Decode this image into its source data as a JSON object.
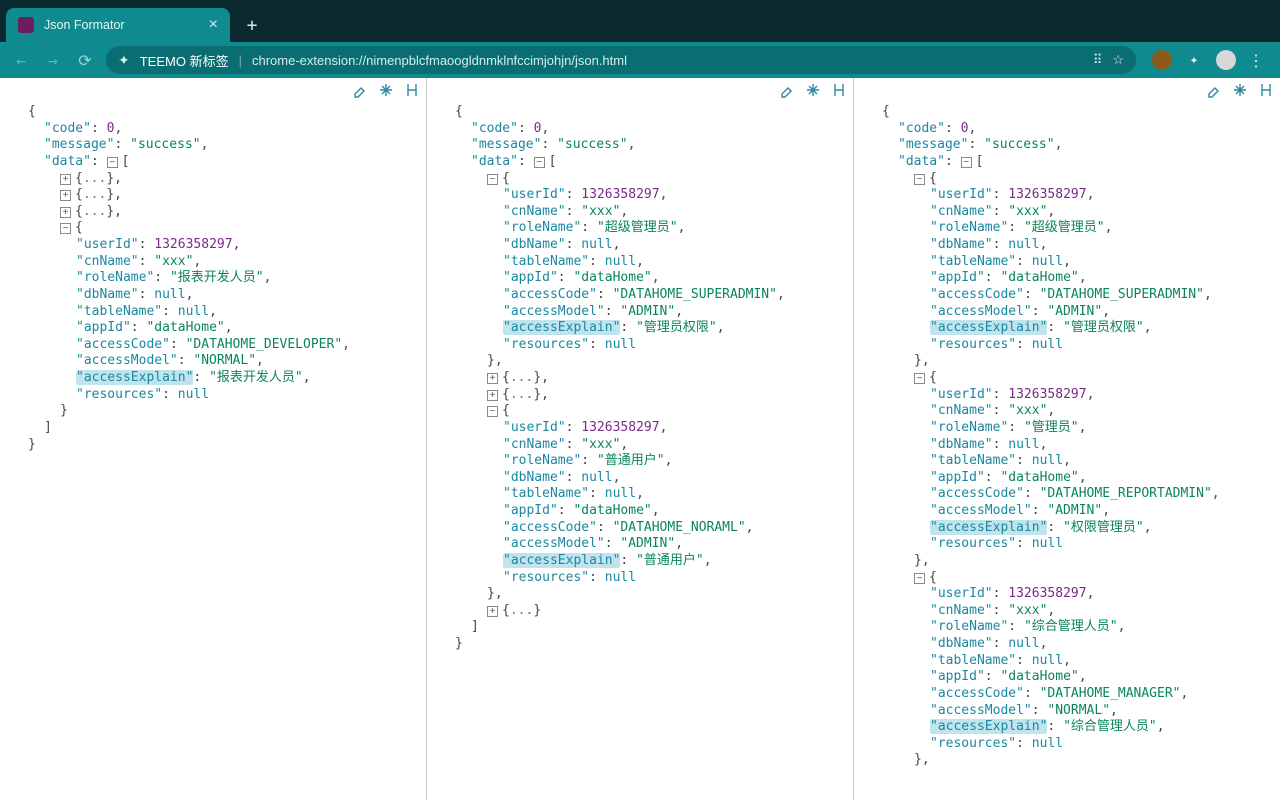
{
  "browser": {
    "tab_title": "Json Formator",
    "url_label": "TEEMO 新标签",
    "url_path": "chrome-extension://nimenpblcfmaoogldnmklnfccimjohjn/json.html"
  },
  "toolbar_icons": {
    "eraser": "eraser-icon",
    "collapse_all": "collapse-all-icon",
    "align": "align-icon"
  },
  "panel1": {
    "root": {
      "code_key": "code",
      "code_val": 0,
      "message_key": "message",
      "message_val": "success",
      "data_key": "data",
      "collapsed_rows": 3,
      "item": {
        "userId_key": "userId",
        "userId_val": 1326358297,
        "cnName_key": "cnName",
        "cnName_val": "xxx",
        "roleName_key": "roleName",
        "roleName_val": "报表开发人员",
        "dbName_key": "dbName",
        "tableName_key": "tableName",
        "appId_key": "appId",
        "appId_val": "dataHome",
        "accessCode_key": "accessCode",
        "accessCode_val": "DATAHOME_DEVELOPER",
        "accessModel_key": "accessModel",
        "accessModel_val": "NORMAL",
        "accessExplain_key": "accessExplain",
        "accessExplain_val": "报表开发人员",
        "resources_key": "resources"
      }
    }
  },
  "panel2": {
    "root": {
      "code_key": "code",
      "code_val": 0,
      "message_key": "message",
      "message_val": "success",
      "data_key": "data",
      "item1": {
        "userId_key": "userId",
        "userId_val": 1326358297,
        "cnName_key": "cnName",
        "cnName_val": "xxx",
        "roleName_key": "roleName",
        "roleName_val": "超级管理员",
        "dbName_key": "dbName",
        "tableName_key": "tableName",
        "appId_key": "appId",
        "appId_val": "dataHome",
        "accessCode_key": "accessCode",
        "accessCode_val": "DATAHOME_SUPERADMIN",
        "accessModel_key": "accessModel",
        "accessModel_val": "ADMIN",
        "accessExplain_key": "accessExplain",
        "accessExplain_val": "管理员权限",
        "resources_key": "resources"
      },
      "collapsed_rows_mid": 2,
      "item2": {
        "userId_key": "userId",
        "userId_val": 1326358297,
        "cnName_key": "cnName",
        "cnName_val": "xxx",
        "roleName_key": "roleName",
        "roleName_val": "普通用户",
        "dbName_key": "dbName",
        "tableName_key": "tableName",
        "appId_key": "appId",
        "appId_val": "dataHome",
        "accessCode_key": "accessCode",
        "accessCode_val": "DATAHOME_NORAML",
        "accessModel_key": "accessModel",
        "accessModel_val": "ADMIN",
        "accessExplain_key": "accessExplain",
        "accessExplain_val": "普通用户",
        "resources_key": "resources"
      },
      "collapsed_rows_end": 1
    }
  },
  "panel3": {
    "root": {
      "code_key": "code",
      "code_val": 0,
      "message_key": "message",
      "message_val": "success",
      "data_key": "data",
      "item1": {
        "userId_key": "userId",
        "userId_val": 1326358297,
        "cnName_key": "cnName",
        "cnName_val": "xxx",
        "roleName_key": "roleName",
        "roleName_val": "超级管理员",
        "dbName_key": "dbName",
        "tableName_key": "tableName",
        "appId_key": "appId",
        "appId_val": "dataHome",
        "accessCode_key": "accessCode",
        "accessCode_val": "DATAHOME_SUPERADMIN",
        "accessModel_key": "accessModel",
        "accessModel_val": "ADMIN",
        "accessExplain_key": "accessExplain",
        "accessExplain_val": "管理员权限",
        "resources_key": "resources"
      },
      "item2": {
        "userId_key": "userId",
        "userId_val": 1326358297,
        "cnName_key": "cnName",
        "cnName_val": "xxx",
        "roleName_key": "roleName",
        "roleName_val": "管理员",
        "dbName_key": "dbName",
        "tableName_key": "tableName",
        "appId_key": "appId",
        "appId_val": "dataHome",
        "accessCode_key": "accessCode",
        "accessCode_val": "DATAHOME_REPORTADMIN",
        "accessModel_key": "accessModel",
        "accessModel_val": "ADMIN",
        "accessExplain_key": "accessExplain",
        "accessExplain_val": "权限管理员",
        "resources_key": "resources"
      },
      "item3": {
        "userId_key": "userId",
        "userId_val": 1326358297,
        "cnName_key": "cnName",
        "cnName_val": "xxx",
        "roleName_key": "roleName",
        "roleName_val": "综合管理人员",
        "dbName_key": "dbName",
        "tableName_key": "tableName",
        "appId_key": "appId",
        "appId_val": "dataHome",
        "accessCode_key": "accessCode",
        "accessCode_val": "DATAHOME_MANAGER",
        "accessModel_key": "accessModel",
        "accessModel_val": "NORMAL",
        "accessExplain_key": "accessExplain",
        "accessExplain_val": "综合管理人员",
        "resources_key": "resources"
      }
    }
  },
  "null_literal": "null"
}
